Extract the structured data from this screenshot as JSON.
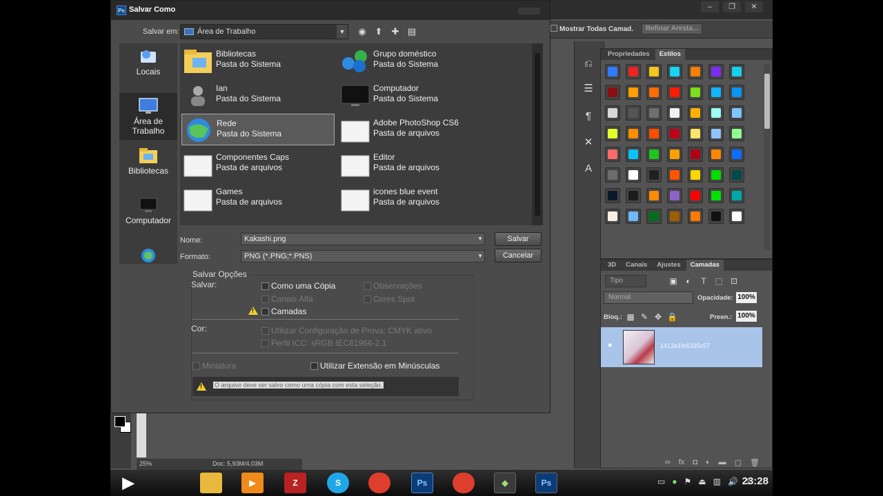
{
  "photoshop": {
    "options": {
      "show_all_layers": "Mostrar Todas Camad.",
      "refine_edge": "Refinar Aresta..."
    },
    "styles_panel": {
      "tabs": [
        "Propriedades",
        "Estilos"
      ],
      "active_tab": "Estilos",
      "swatch_colors": [
        "#2f7bff",
        "#ee2222",
        "#f3c61c",
        "#16d3f5",
        "#f78000",
        "#7b2cf2",
        "#12d0ee",
        "#8b0f12",
        "#ffa000",
        "#ff6c00",
        "#ff1c00",
        "#7be01a",
        "#12b3ff",
        "#0a94f5",
        "#d8d8d8",
        "#555555",
        "#6f6f6f",
        "#f2f2f2",
        "#ffb300",
        "#a0fff3",
        "#7dc6ff",
        "#e2ff2d",
        "#ff8d00",
        "#ff4d00",
        "#c3001a",
        "#ffe566",
        "#8ec5ff",
        "#8fff8f",
        "#ff6a6a",
        "#0ac2ff",
        "#1cc41c",
        "#ffa000",
        "#b10012",
        "#ff8800",
        "#0d6dff",
        "#6c6c6c",
        "#ffffff",
        "#202020",
        "#ff5500",
        "#ffd700",
        "#00dd00",
        "#004a4a",
        "#0a1a2a",
        "#1c1c1c",
        "#ff8a00",
        "#8d63c6",
        "#ff0000",
        "#00e100",
        "#00a9a9",
        "#f7efe6",
        "#6fb7ff",
        "#006f1a",
        "#9f5d00",
        "#ff7a00",
        "#111111",
        "#ffffff"
      ]
    },
    "layers_panel": {
      "tabs": [
        "3D",
        "Canais",
        "Ajustes",
        "Camadas"
      ],
      "active_tab": "Camadas",
      "kind_filter": "Tipo",
      "blend_mode": "Normal",
      "opacity_label": "Opacidade:",
      "opacity_value": "100%",
      "lock_label": "Bloq.:",
      "fill_label": "Preen.:",
      "fill_value": "100%",
      "layer_name": "1413a1fe6335c57"
    },
    "status": {
      "zoom": "25%",
      "doc": "Doc: 5,93M/4,03M"
    }
  },
  "dialog": {
    "title": "Salvar Como",
    "save_in_label": "Salvar em:",
    "save_in_value": "Área de Trabalho",
    "places": [
      {
        "label": "Locais"
      },
      {
        "label": "Área de Trabalho"
      },
      {
        "label": "Bibliotecas"
      },
      {
        "label": "Computador"
      }
    ],
    "files": [
      {
        "name": "Bibliotecas",
        "type": "Pasta do Sistema",
        "icon": "libraries-folder-icon"
      },
      {
        "name": "Grupo doméstico",
        "type": "Pasta do Sistema",
        "icon": "homegroup-icon"
      },
      {
        "name": "Ian",
        "type": "Pasta do Sistema",
        "icon": "user-icon"
      },
      {
        "name": "Computador",
        "type": "Pasta do Sistema",
        "icon": "computer-icon"
      },
      {
        "name": "Rede",
        "type": "Pasta do Sistema",
        "icon": "network-icon"
      },
      {
        "name": "Adobe PhotoShop CS6",
        "type": "Pasta de arquivos",
        "icon": "folder-icon"
      },
      {
        "name": "Componentes Caps",
        "type": "Pasta de arquivos",
        "icon": "folder-icon"
      },
      {
        "name": "Editor",
        "type": "Pasta de arquivos",
        "icon": "folder-icon"
      },
      {
        "name": "Games",
        "type": "Pasta de arquivos",
        "icon": "folder-icon"
      },
      {
        "name": "icones blue event",
        "type": "Pasta de arquivos",
        "icon": "folder-icon"
      }
    ],
    "name_label": "Nome:",
    "name_value": "Kakashi.png",
    "format_label": "Formato:",
    "format_value": "PNG (*.PNG;*.PNS)",
    "save_button": "Salvar",
    "cancel_button": "Cancelar",
    "save_options_title": "Salvar Opções",
    "save_label": "Salvar:",
    "as_copy": "Como uma Cópia",
    "notes": "Observações",
    "alpha_channels": "Canais Alfa",
    "spot_colors": "Cores Spot",
    "layers": "Camadas",
    "color_label": "Cor:",
    "use_proof": "Utilizar Configuração de Prova: CMYK ativo",
    "icc_profile": "Perfil ICC: sRGB IEC61966-2.1",
    "thumbnail": "Miniatura",
    "lowercase_ext": "Utilizar Extensão em Minúsculas",
    "warning_text": "O arquivo deve ser salvo como uma cópia com esta seleção."
  },
  "taskbar": {
    "clock": "23:28"
  }
}
